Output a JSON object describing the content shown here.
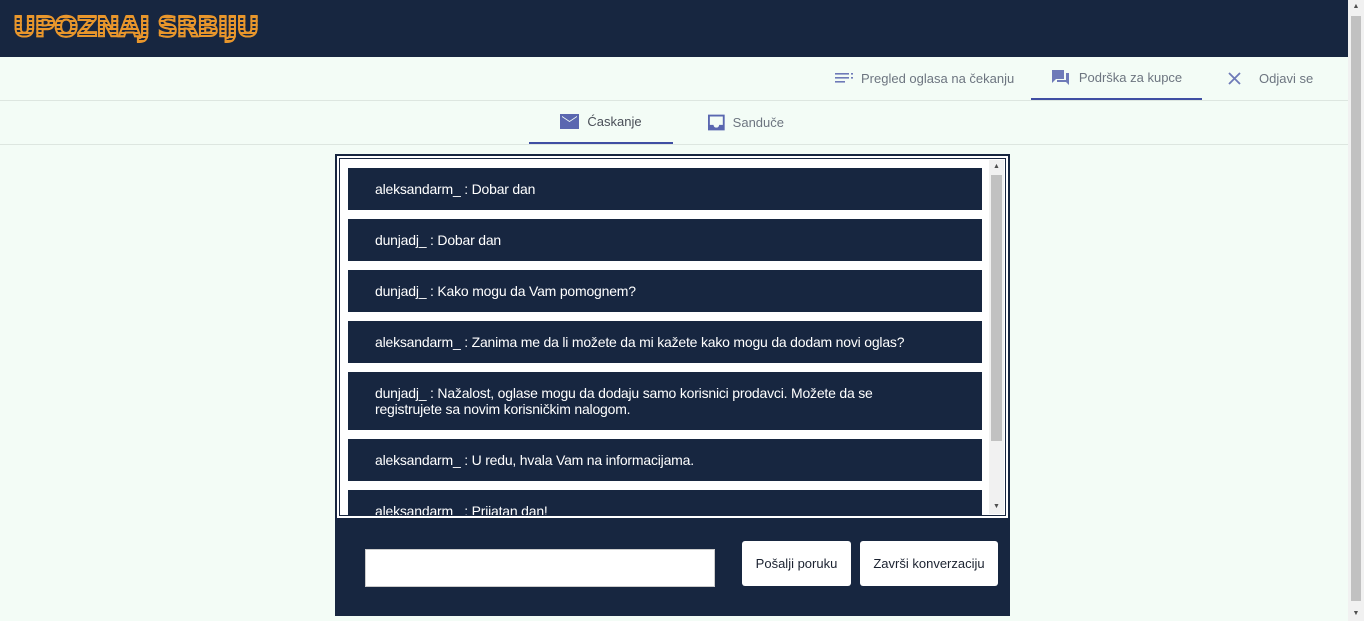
{
  "header": {
    "logo_text": "UPOZNAJ SRBIJU"
  },
  "nav": {
    "items": [
      {
        "label": "Pregled oglasa na čekanju",
        "icon": "list-icon"
      },
      {
        "label": "Podrška za kupce",
        "icon": "chat-icon",
        "active": true
      },
      {
        "label": "Odjavi se",
        "icon": "close-icon"
      }
    ]
  },
  "tabs": [
    {
      "label": "Ćaskanje",
      "icon": "mail-icon",
      "active": true
    },
    {
      "label": "Sandučе",
      "icon": "inbox-icon"
    }
  ],
  "chat": {
    "messages": [
      "aleksandarm_ : Dobar dan",
      "dunjadj_ : Dobar dan",
      "dunjadj_ : Kako mogu da Vam pomognem?",
      "aleksandarm_ : Zanima me da li možete da mi kažete kako mogu da dodam novi oglas?",
      "dunjadj_ : Nažalost, oglase mogu da dodaju samo korisnici prodavci. Možete da se registrujete sa novim korisničkim nalogom.",
      "aleksandarm_ : U redu, hvala Vam na informacijama.",
      "aleksandarm_ : Prijatan dan!"
    ]
  },
  "composer": {
    "input_value": "",
    "send_label": "Pošalji poruku",
    "end_label": "Završi konverzaciju"
  },
  "colors": {
    "navy": "#172640",
    "accent": "#3f4ea3",
    "background": "#f3fcf6",
    "logo": "#e8962c"
  }
}
